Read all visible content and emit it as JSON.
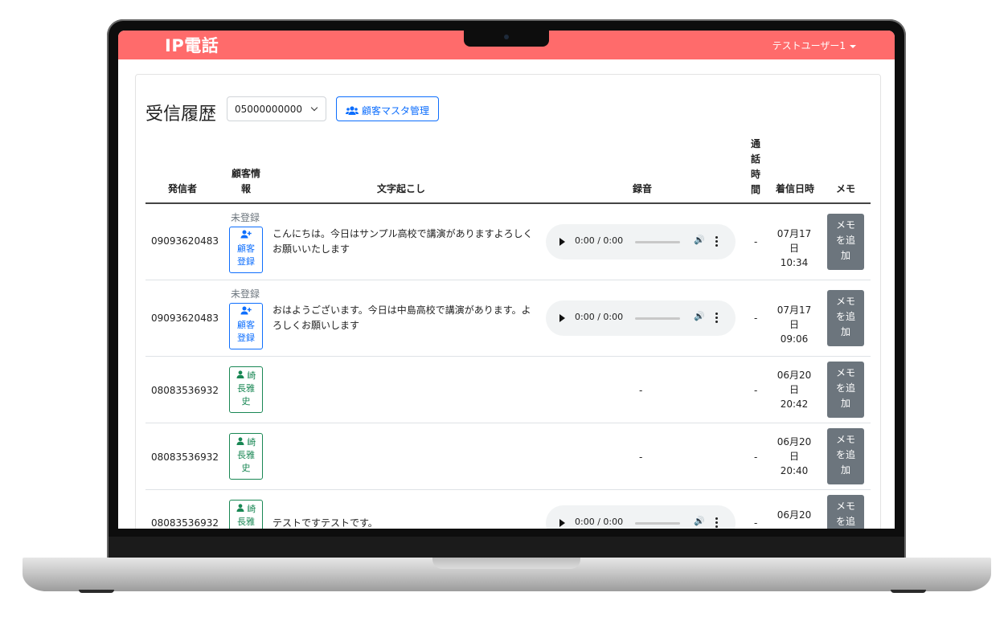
{
  "app": {
    "brand": "IP電話",
    "user": "テストユーザー1"
  },
  "page": {
    "title": "受信履歴",
    "selected_line": "05000000000",
    "master_button": "顧客マスタ管理"
  },
  "table": {
    "headers": {
      "caller": "発信者",
      "customer_info_1": "顧客情",
      "customer_info_2": "報",
      "transcript": "文字起こし",
      "recording": "録音",
      "duration_1": "通",
      "duration_2": "話",
      "duration_3": "時",
      "duration_4": "間",
      "received_at": "着信日時",
      "memo": "メモ"
    },
    "rows": [
      {
        "caller": "09093620483",
        "status": "未登録",
        "register_l1": "顧客",
        "register_l2": "登録",
        "transcript": "こんにちは。今日はサンプル高校で講演がありますよろしくお願いいたします",
        "player_time": "0:00 / 0:00",
        "duration": "-",
        "date_l1": "07月17",
        "date_l2": "日 10:34",
        "memo_l1": "メモ",
        "memo_l2": "を追",
        "memo_l3": "加"
      },
      {
        "caller": "09093620483",
        "status": "未登録",
        "register_l1": "顧客",
        "register_l2": "登録",
        "transcript": "おはようございます。今日は中島高校で講演があります。よろしくお願いします",
        "player_time": "0:00 / 0:00",
        "duration": "-",
        "date_l1": "07月17",
        "date_l2": "日 09:06",
        "memo_l1": "メモ",
        "memo_l2": "を追",
        "memo_l3": "加"
      },
      {
        "caller": "08083536932",
        "cust_l1": "崎",
        "cust_l2": "長雅",
        "cust_l3": "史",
        "recording": "-",
        "duration": "-",
        "date_l1": "06月20",
        "date_l2": "日 20:42",
        "memo_l1": "メモ",
        "memo_l2": "を追",
        "memo_l3": "加"
      },
      {
        "caller": "08083536932",
        "cust_l1": "崎",
        "cust_l2": "長雅",
        "cust_l3": "史",
        "recording": "-",
        "duration": "-",
        "date_l1": "06月20",
        "date_l2": "日 20:40",
        "memo_l1": "メモ",
        "memo_l2": "を追",
        "memo_l3": "加"
      },
      {
        "caller": "08083536932",
        "cust_l1": "崎",
        "cust_l2": "長雅",
        "transcript": "テストですテストです。",
        "player_time": "0:00 / 0:00",
        "duration": "-",
        "date_l1": "06月20",
        "memo_l1": "メモ",
        "memo_l2": "を追"
      }
    ]
  },
  "colors": {
    "navbar": "#ff6b6b",
    "primary": "#0d6efd",
    "success": "#198754",
    "secondary": "#6c757d"
  }
}
